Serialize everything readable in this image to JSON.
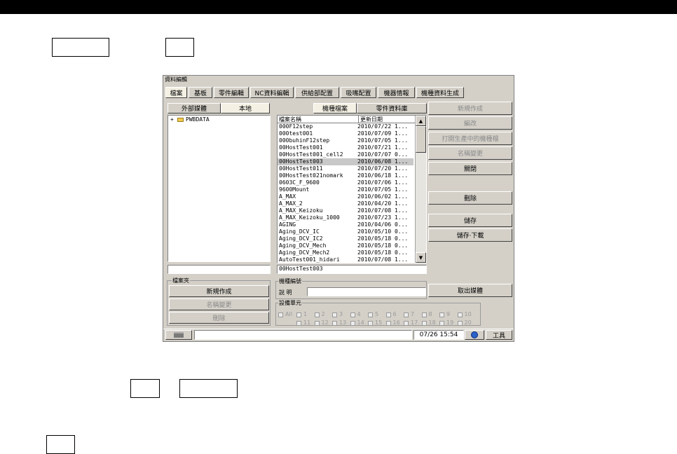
{
  "app": {
    "title": "資料編輯"
  },
  "menu": [
    {
      "label": "檔案"
    },
    {
      "label": "基板"
    },
    {
      "label": "零件編輯"
    },
    {
      "label": "NC資料編輯"
    },
    {
      "label": "供給部配置"
    },
    {
      "label": "吸嘴配置"
    },
    {
      "label": "機器情報"
    },
    {
      "label": "機種資料生成"
    }
  ],
  "source_tabs": [
    {
      "label": "外部媒體"
    },
    {
      "label": "本地"
    }
  ],
  "file_tabs": [
    {
      "label": "機種檔案"
    },
    {
      "label": "零件資料庫"
    }
  ],
  "tree": {
    "root": "PWBDATA",
    "expand": "+"
  },
  "file_list": {
    "columns": [
      "檔案名稱",
      "更新日期"
    ],
    "rows": [
      {
        "name": "000F12step",
        "date": "2010/07/22 1..."
      },
      {
        "name": "000test001",
        "date": "2010/07/09 1..."
      },
      {
        "name": "000buhinF12step",
        "date": "2010/07/05 1..."
      },
      {
        "name": "00HostTest001",
        "date": "2010/07/21 1..."
      },
      {
        "name": "00HostTest001_cell2",
        "date": "2010/07/07 0..."
      },
      {
        "name": "00HostTest003",
        "date": "2010/06/08 1..."
      },
      {
        "name": "00HostTest011",
        "date": "2010/07/20 1..."
      },
      {
        "name": "00HostTest021nomark",
        "date": "2010/06/18 1..."
      },
      {
        "name": "0603C_F_9600",
        "date": "2010/07/06 1..."
      },
      {
        "name": "9600Mount",
        "date": "2010/07/05 1..."
      },
      {
        "name": "A_MAX",
        "date": "2010/06/02 1..."
      },
      {
        "name": "A_MAX_2",
        "date": "2010/04/20 1..."
      },
      {
        "name": "A_MAX_Keizoku",
        "date": "2010/07/08 1..."
      },
      {
        "name": "A_MAX_Keizoku_1000",
        "date": "2010/07/23 1..."
      },
      {
        "name": "AGING",
        "date": "2010/04/06 0..."
      },
      {
        "name": "Aging_DCV_IC",
        "date": "2010/05/10 0..."
      },
      {
        "name": "Aging_DCV_IC2",
        "date": "2010/05/18 0..."
      },
      {
        "name": "Aging_DCV_Mech",
        "date": "2010/05/18 0..."
      },
      {
        "name": "Aging_DCV_Mech2",
        "date": "2010/05/18 0..."
      },
      {
        "name": "AutoTest001_hidari",
        "date": "2010/07/08 1..."
      }
    ]
  },
  "selected_file": "00HostTest003",
  "right_buttons": {
    "new": "新規作成",
    "edit": "編改",
    "open_running": "打開生產中的機種檔",
    "rename": "名稱變更",
    "close": "關閉",
    "delete": "刪除",
    "save": "儲存",
    "save_download": "儲存·下載",
    "eject": "取出媒體"
  },
  "folder_group": {
    "title": "檔案夾",
    "new": "新規作成",
    "rename": "名稱變更",
    "delete": "刪除"
  },
  "model_id": {
    "title": "機種編號",
    "desc_label": "說 明",
    "desc_value": ""
  },
  "units": {
    "title": "設備單元",
    "row1": [
      "All",
      "1",
      "2",
      "3",
      "4",
      "5",
      "6",
      "7",
      "8",
      "9",
      "10"
    ],
    "row2": [
      "11",
      "12",
      "13",
      "14",
      "15",
      "16",
      "17",
      "18",
      "19",
      "20"
    ]
  },
  "statusbar": {
    "datetime": "07/26 15:54",
    "tools_label": "工具"
  }
}
